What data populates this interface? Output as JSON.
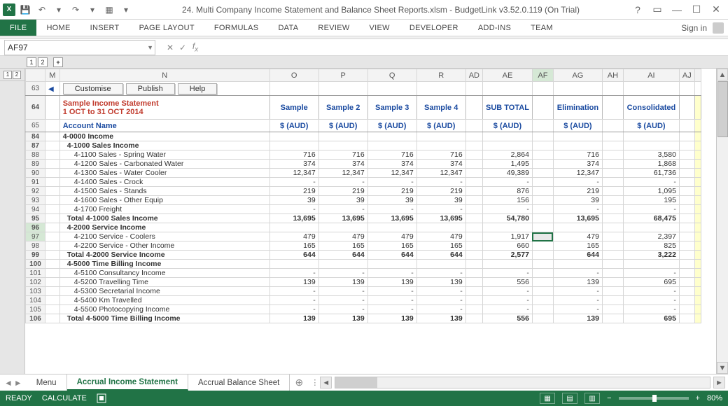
{
  "window": {
    "title": "24. Multi Company Income Statement and Balance Sheet Reports.xlsm - BudgetLink v3.52.0.119 (On Trial)",
    "sign_in": "Sign in"
  },
  "ribbon": {
    "file": "FILE",
    "tabs": [
      "HOME",
      "INSERT",
      "PAGE LAYOUT",
      "FORMULAS",
      "DATA",
      "REVIEW",
      "VIEW",
      "DEVELOPER",
      "ADD-INS",
      "Team"
    ]
  },
  "formula_bar": {
    "namebox": "AF97",
    "formula": ""
  },
  "outline": {
    "col_levels": [
      "1",
      "2"
    ],
    "col_plus": "+",
    "row_levels": [
      "1",
      "2"
    ]
  },
  "sheet": {
    "col_headers": [
      "M",
      "N",
      "O",
      "P",
      "Q",
      "R",
      "AD",
      "AE",
      "AF",
      "AG",
      "AH",
      "AI",
      "AJ"
    ],
    "active_col": "AF",
    "active_row": "97",
    "toolbar": {
      "customise": "Customise",
      "publish": "Publish",
      "help": "Help"
    },
    "report": {
      "title": "Sample Income Statement",
      "period": "1 OCT to 31 OCT 2014"
    },
    "headers": {
      "sample": "Sample",
      "sample2": "Sample 2",
      "sample3": "Sample 3",
      "sample4": "Sample 4",
      "subtotal": "SUB TOTAL",
      "elimination": "Elimination",
      "consolidated": "Consolidated"
    },
    "account_name_label": "Account Name",
    "currency": "$ (AUD)",
    "rows": [
      {
        "rn": "63",
        "type": "toolbar"
      },
      {
        "rn": "64",
        "type": "titleband"
      },
      {
        "rn": "65",
        "type": "acctheader"
      },
      {
        "rn": "84",
        "type": "section",
        "label": "4-0000 Income",
        "bold": true
      },
      {
        "rn": "87",
        "type": "section",
        "label": "4-1000 Sales Income",
        "bold": true,
        "ind": 1
      },
      {
        "rn": "88",
        "label": "4-1100 Sales - Spring Water",
        "ind": 2,
        "O": "716",
        "P": "716",
        "Q": "716",
        "R": "716",
        "AE": "2,864",
        "AG": "716",
        "AI": "3,580"
      },
      {
        "rn": "89",
        "label": "4-1200 Sales - Carbonated Water",
        "ind": 2,
        "O": "374",
        "P": "374",
        "Q": "374",
        "R": "374",
        "AE": "1,495",
        "AG": "374",
        "AI": "1,868"
      },
      {
        "rn": "90",
        "label": "4-1300 Sales - Water Cooler",
        "ind": 2,
        "O": "12,347",
        "P": "12,347",
        "Q": "12,347",
        "R": "12,347",
        "AE": "49,389",
        "AG": "12,347",
        "AI": "61,736"
      },
      {
        "rn": "91",
        "label": "4-1400 Sales - Crock",
        "ind": 2,
        "O": "-",
        "P": "-",
        "Q": "-",
        "R": "-",
        "AE": "-",
        "AG": "-",
        "AI": "-"
      },
      {
        "rn": "92",
        "label": "4-1500 Sales - Stands",
        "ind": 2,
        "O": "219",
        "P": "219",
        "Q": "219",
        "R": "219",
        "AE": "876",
        "AG": "219",
        "AI": "1,095"
      },
      {
        "rn": "93",
        "label": "4-1600 Sales - Other Equip",
        "ind": 2,
        "O": "39",
        "P": "39",
        "Q": "39",
        "R": "39",
        "AE": "156",
        "AG": "39",
        "AI": "195"
      },
      {
        "rn": "94",
        "label": "4-1700 Freight",
        "ind": 2,
        "O": "-",
        "P": "-",
        "Q": "-",
        "R": "-",
        "AE": "-",
        "AG": "-",
        "AI": "-"
      },
      {
        "rn": "95",
        "label": "Total 4-1000 Sales Income",
        "bold": true,
        "ind": 1,
        "O": "13,695",
        "P": "13,695",
        "Q": "13,695",
        "R": "13,695",
        "AE": "54,780",
        "AG": "13,695",
        "AI": "68,475"
      },
      {
        "rn": "96",
        "type": "section",
        "label": "4-2000 Service Income",
        "bold": true,
        "ind": 1,
        "selrow": true
      },
      {
        "rn": "97",
        "label": "4-2100 Service - Coolers",
        "ind": 2,
        "O": "479",
        "P": "479",
        "Q": "479",
        "R": "479",
        "AE": "1,917",
        "AG": "479",
        "AI": "2,397",
        "active": true,
        "selrow": true
      },
      {
        "rn": "98",
        "label": "4-2200 Service - Other Income",
        "ind": 2,
        "O": "165",
        "P": "165",
        "Q": "165",
        "R": "165",
        "AE": "660",
        "AG": "165",
        "AI": "825"
      },
      {
        "rn": "99",
        "label": "Total 4-2000 Service Income",
        "bold": true,
        "ind": 1,
        "O": "644",
        "P": "644",
        "Q": "644",
        "R": "644",
        "AE": "2,577",
        "AG": "644",
        "AI": "3,222"
      },
      {
        "rn": "100",
        "type": "section",
        "label": "4-5000 Time Billing Income",
        "bold": true,
        "ind": 1
      },
      {
        "rn": "101",
        "label": "4-5100 Consultancy Income",
        "ind": 2,
        "O": "-",
        "P": "-",
        "Q": "-",
        "R": "-",
        "AE": "-",
        "AG": "-",
        "AI": "-"
      },
      {
        "rn": "102",
        "label": "4-5200 Travelling Time",
        "ind": 2,
        "O": "139",
        "P": "139",
        "Q": "139",
        "R": "139",
        "AE": "556",
        "AG": "139",
        "AI": "695"
      },
      {
        "rn": "103",
        "label": "4-5300 Secretarial Income",
        "ind": 2,
        "O": "-",
        "P": "-",
        "Q": "-",
        "R": "-",
        "AE": "-",
        "AG": "-",
        "AI": "-"
      },
      {
        "rn": "104",
        "label": "4-5400 Km Travelled",
        "ind": 2,
        "O": "-",
        "P": "-",
        "Q": "-",
        "R": "-",
        "AE": "-",
        "AG": "-",
        "AI": "-"
      },
      {
        "rn": "105",
        "label": "4-5500 Photocopying Income",
        "ind": 2,
        "O": "-",
        "P": "-",
        "Q": "-",
        "R": "-",
        "AE": "-",
        "AG": "-",
        "AI": "-"
      },
      {
        "rn": "106",
        "label": "Total 4-5000 Time Billing Income",
        "bold": true,
        "ind": 1,
        "O": "139",
        "P": "139",
        "Q": "139",
        "R": "139",
        "AE": "556",
        "AG": "139",
        "AI": "695"
      }
    ]
  },
  "tabs": {
    "sheets": [
      "Menu",
      "Accrual Income Statement",
      "Accrual Balance Sheet"
    ],
    "active_index": 1,
    "add": "+"
  },
  "status": {
    "ready": "READY",
    "calculate": "CALCULATE",
    "zoom": "80%",
    "minus": "−",
    "plus": "+"
  }
}
